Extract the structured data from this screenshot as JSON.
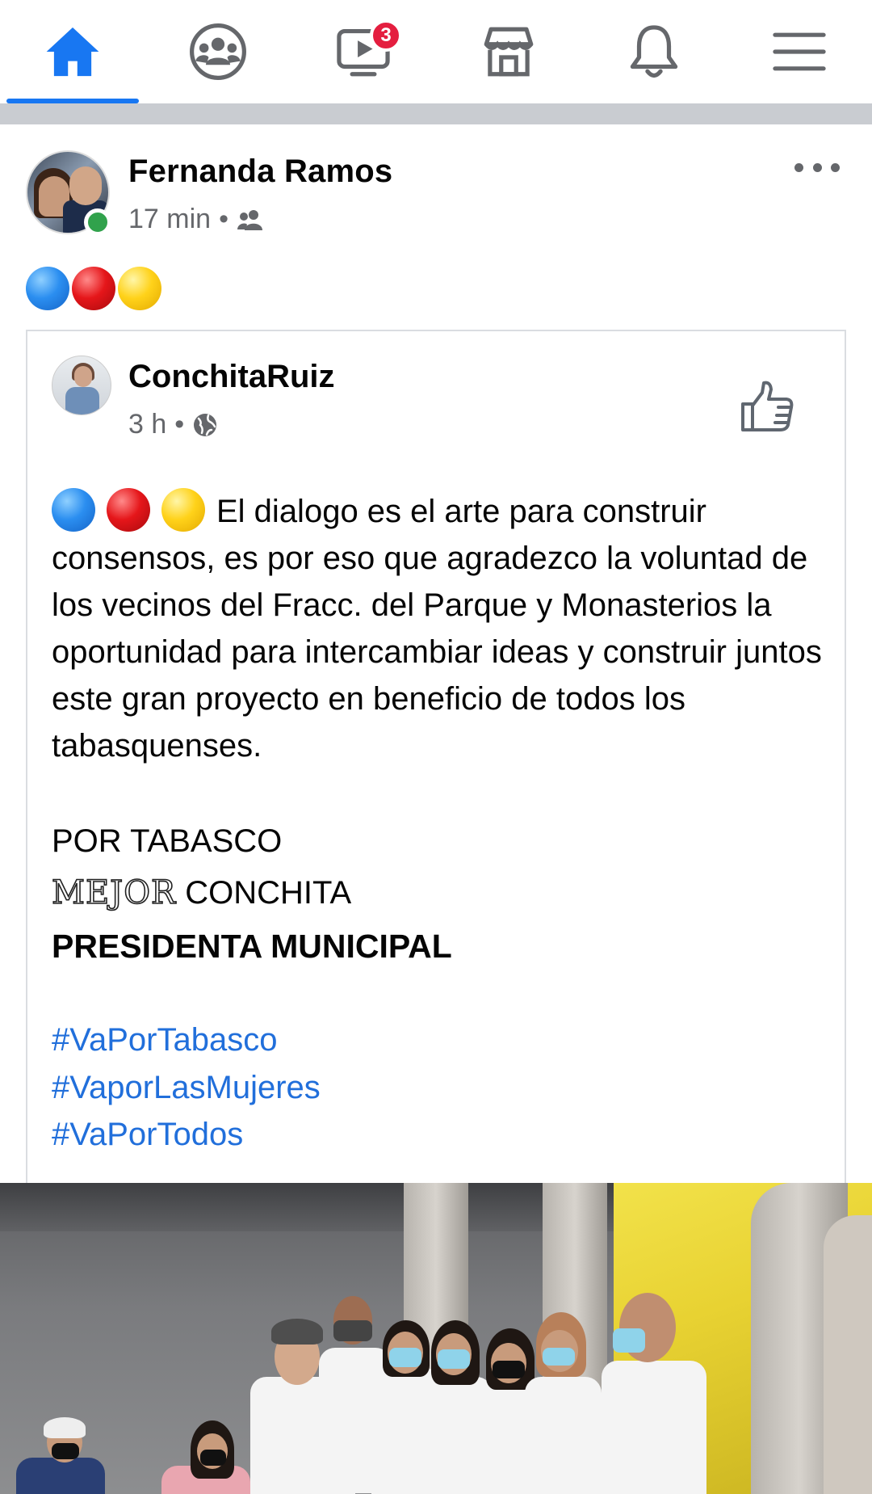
{
  "nav": {
    "items": [
      "home",
      "groups",
      "watch",
      "marketplace",
      "notifications",
      "menu"
    ],
    "active": "home",
    "watch_badge": "3",
    "accent_color": "#1877f2",
    "badge_color": "#e41e3f"
  },
  "post": {
    "author": "Fernanda Ramos",
    "time": "17 min",
    "separator": "•",
    "audience_icon": "friends-icon",
    "emoji_circles": [
      "blue",
      "red",
      "yellow"
    ]
  },
  "shared": {
    "author": "ConchitaRuiz",
    "time": "3 h",
    "separator": "•",
    "audience_icon": "globe-icon",
    "body": "El dialogo es el arte para construir consensos, es por eso que agradezco la voluntad de los vecinos del Fracc. del Parque y Monasterios la oportunidad para intercambiar ideas y construir juntos este gran proyecto en beneficio de todos los tabasquenses.",
    "line1": "POR TABASCO",
    "line2_outline": "MEJOR",
    "line2_rest": " CONCHITA",
    "line3": "PRESIDENTA MUNICIPAL",
    "hashtags": [
      "#VaPorTabasco",
      "#VaporLasMujeres",
      "#VaPorTodos"
    ]
  }
}
